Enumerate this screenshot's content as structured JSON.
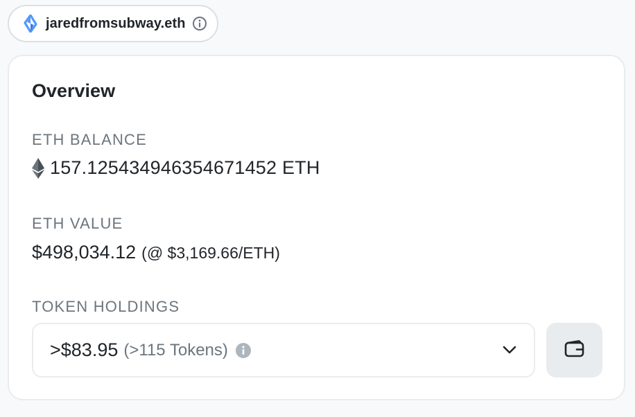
{
  "ens": {
    "name": "jaredfromsubway.eth",
    "logo_icon": "ens-logo-icon",
    "info_icon": "info-icon",
    "logo_color": "#5298ff"
  },
  "overview": {
    "title": "Overview",
    "eth_balance": {
      "label": "ETH BALANCE",
      "icon": "ethereum-icon",
      "value": "157.125434946354671452 ETH"
    },
    "eth_value": {
      "label": "ETH VALUE",
      "value": "$498,034.12",
      "rate": "(@ $3,169.66/ETH)"
    },
    "token_holdings": {
      "label": "TOKEN HOLDINGS",
      "amount": ">$83.95",
      "count": "(>115 Tokens)",
      "info_icon": "info-icon",
      "dropdown_icon": "chevron-down-icon",
      "wallet_icon": "wallet-icon"
    }
  }
}
